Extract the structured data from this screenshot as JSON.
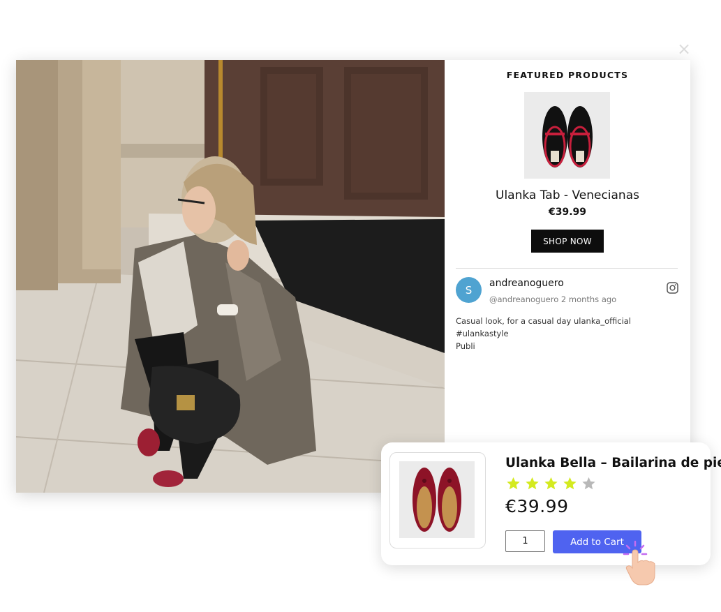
{
  "modal": {
    "close_glyph": "×",
    "featured_title": "FEATURED PRODUCTS",
    "featured_product": {
      "name": "Ulanka Tab - Venecianas",
      "price": "€39.99",
      "cta_label": "SHOP NOW"
    },
    "post": {
      "avatar_letter": "S",
      "username": "andreanoguero",
      "handle_meta": "@andreanoguero 2 months ago",
      "caption_lines": [
        "Casual look, for a casual day  ulanka_official #ulankastyle",
        "Publi"
      ],
      "source_icon": "instagram-icon"
    }
  },
  "cart_card": {
    "product_name": "Ulanka Bella – Bailarina de piel",
    "rating": 4,
    "rating_max": 5,
    "price": "€39.99",
    "quantity": "1",
    "add_to_cart_label": "Add to Cart"
  },
  "colors": {
    "avatar_bg": "#4fa3d1",
    "shop_button_bg": "#0d0d0d",
    "add_to_cart_bg": "#4f63f0",
    "star_filled": "#d4ea1f",
    "star_empty": "#b8b8b8",
    "cursor_sparkle": "#c46cf0"
  },
  "icons": {
    "cursor": "pointer-hand-icon"
  }
}
